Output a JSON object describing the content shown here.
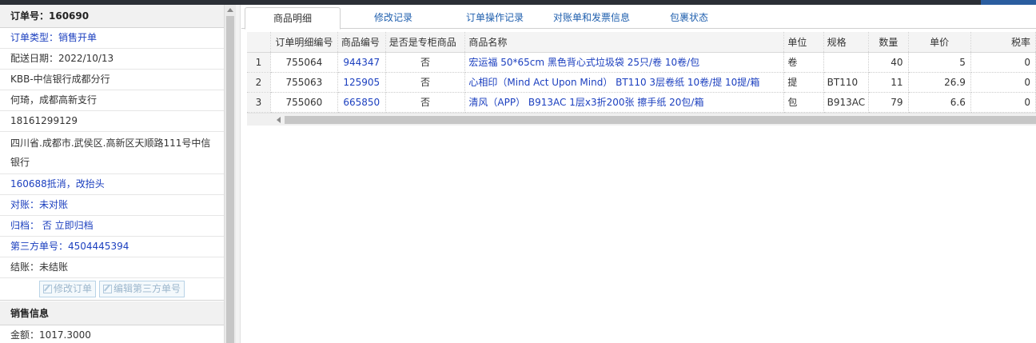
{
  "order": {
    "title": "订单号：160690",
    "type_label": "订单类型：",
    "type_value": "销售开单",
    "delivery_date": "配送日期：2022/10/13",
    "customer": "KBB-中信银行成都分行",
    "contact": "何琦，成都高新支行",
    "phone": "18161299129",
    "address": "四川省.成都市.武侯区.高新区天顺路111号中信银行",
    "note": "160688抵消，改抬头",
    "reconcile": "对账：未对账",
    "archive": "归档： 否 立即归档",
    "third_party": "第三方单号：4504445394",
    "settlement": "结账：未结账",
    "edit_order_btn": "修改订单",
    "edit_third_party_btn": "编辑第三方单号"
  },
  "sales": {
    "title": "销售信息",
    "amount": "金额：1017.3000"
  },
  "tabs": [
    {
      "label": "商品明细"
    },
    {
      "label": "修改记录"
    },
    {
      "label": "订单操作记录"
    },
    {
      "label": "对账单和发票信息"
    },
    {
      "label": "包裹状态"
    }
  ],
  "table": {
    "columns": [
      "订单明细编号",
      "商品编号",
      "是否是专柜商品",
      "商品名称",
      "单位",
      "规格",
      "数量",
      "单价",
      "税率"
    ],
    "rows": [
      {
        "n": "1",
        "detail_id": "755064",
        "product_id": "944347",
        "counter": "否",
        "name": "宏运福 50*65cm 黑色背心式垃圾袋 25只/卷 10卷/包",
        "unit": "卷",
        "spec": "",
        "qty": "40",
        "price": "5",
        "tax": "0"
      },
      {
        "n": "2",
        "detail_id": "755063",
        "product_id": "125905",
        "counter": "否",
        "name": "心相印（Mind Act Upon Mind） BT110 3层卷纸 10卷/提 10提/箱",
        "unit": "提",
        "spec": "BT110",
        "qty": "11",
        "price": "26.9",
        "tax": "0"
      },
      {
        "n": "3",
        "detail_id": "755060",
        "product_id": "665850",
        "counter": "否",
        "name": "清风（APP） B913AC 1层x3折200张 擦手纸 20包/箱",
        "unit": "包",
        "spec": "B913AC",
        "qty": "79",
        "price": "6.6",
        "tax": "0"
      }
    ]
  }
}
